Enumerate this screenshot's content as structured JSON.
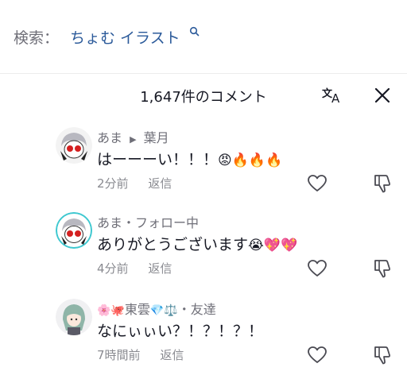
{
  "search": {
    "prefix": "検索：",
    "query": "ちょむ イラスト"
  },
  "comments_header": {
    "count_text": "1,647件のコメント"
  },
  "comments": [
    {
      "user": "あま",
      "reply_to": "葉月",
      "text": "はーーーい！！！",
      "emojis": "😡🔥🔥🔥",
      "time": "2分前",
      "reply_label": "返信"
    },
    {
      "user": "あま",
      "relation": "フォロー中",
      "text": "ありがとうございます",
      "emojis": "😭💖💖",
      "time": "4分前",
      "reply_label": "返信"
    },
    {
      "user_prefix_emojis": "🌸🐙",
      "user": "東雲",
      "user_suffix_emojis": "💎⚖️",
      "relation": "友達",
      "text": "なにぃぃい？！？！？！",
      "time": "7時間前",
      "reply_label": "返信"
    }
  ],
  "icons": {
    "search": "search-icon",
    "translate": "translate-icon",
    "close": "close-icon",
    "like": "heart-icon",
    "dislike": "thumbs-down-icon"
  },
  "colors": {
    "query": "#2b5a9a",
    "muted": "#6f6f78",
    "text": "#161823"
  }
}
